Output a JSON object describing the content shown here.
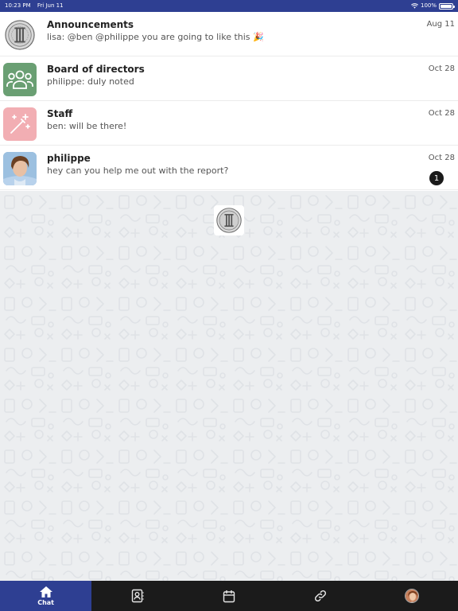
{
  "status_bar": {
    "time": "10:23 PM",
    "date": "Fri Jun 11",
    "battery": "100%",
    "battery_level": 1.0
  },
  "chats": [
    {
      "name": "Announcements",
      "preview": "lisa: @ben @philippe you are going to like this 🎉",
      "date": "Aug 11",
      "avatar_icon": "coin-logo-icon"
    },
    {
      "name": "Board of directors",
      "preview": "philippe: duly noted",
      "date": "Oct 28",
      "avatar_icon": "group-icon",
      "avatar_color": "#6a9f73"
    },
    {
      "name": "Staff",
      "preview": "ben: will be there!",
      "date": "Oct 28",
      "avatar_icon": "magic-wand-icon",
      "avatar_color": "#f2aeb3"
    },
    {
      "name": "philippe",
      "preview": "hey can you help me out with the report?",
      "date": "Oct 28",
      "unread": "1",
      "avatar_icon": "user-photo"
    }
  ],
  "tabs": [
    {
      "label": "Chat",
      "icon": "home-icon",
      "active": true
    },
    {
      "label": "",
      "icon": "contacts-icon"
    },
    {
      "label": "",
      "icon": "calendar-icon"
    },
    {
      "label": "",
      "icon": "link-icon"
    },
    {
      "label": "",
      "icon": "profile-avatar"
    }
  ],
  "colors": {
    "status_bar": "#2e3f92",
    "tab_active": "#2e3f92",
    "tab_bar": "#1b1b1b",
    "background": "#eceef0"
  }
}
